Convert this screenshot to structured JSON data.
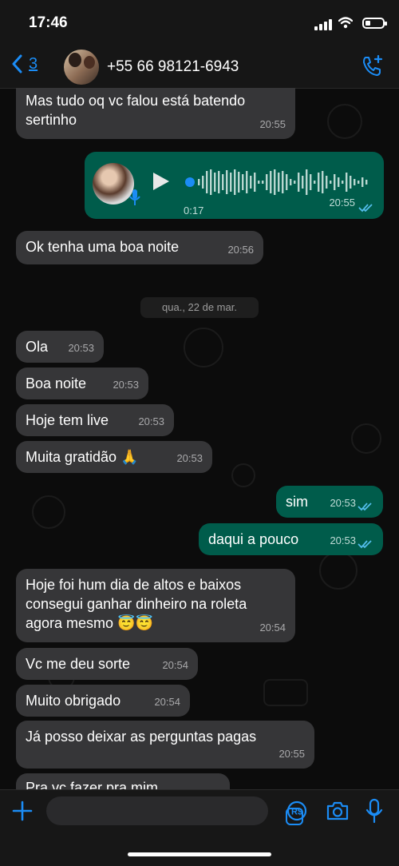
{
  "status": {
    "time": "17:46"
  },
  "header": {
    "back_count": "3",
    "contact": "+55 66 98121-6943"
  },
  "messages": [
    {
      "text": "Mas tudo oq vc falou está batendo sertinho",
      "time": "20:55"
    },
    {
      "time": "20:55"
    },
    {
      "text": "Ok tenha uma boa noite",
      "time": "20:56"
    },
    {
      "text": "Ola",
      "time": "20:53"
    },
    {
      "text": "Boa noite",
      "time": "20:53"
    },
    {
      "text": "Hoje tem live",
      "time": "20:53"
    },
    {
      "text": "Muita gratidão 🙏",
      "time": "20:53"
    },
    {
      "text": "sim",
      "time": "20:53"
    },
    {
      "text": "daqui a pouco",
      "time": "20:53"
    },
    {
      "text": "Hoje foi hum dia de altos e baixos consegui ganhar dinheiro na roleta agora mesmo 😇😇",
      "time": "20:54"
    },
    {
      "text": "Vc me deu sorte",
      "time": "20:54"
    },
    {
      "text": "Muito obrigado",
      "time": "20:54"
    },
    {
      "text": "Já posso deixar as perguntas pagas",
      "time": "20:55"
    },
    {
      "text": "Pra vc fazer pra mim"
    }
  ],
  "voice": {
    "duration": "0:17"
  },
  "date_chip": "qua., 22 de mar.",
  "icons": [
    "back-chevron-icon",
    "call-add-icon",
    "mic-icon",
    "play-icon",
    "plus-icon",
    "sticker-icon",
    "payment-icon",
    "camera-icon",
    "microphone-icon"
  ],
  "colors": {
    "accent": "#1b8cf5",
    "outgoing": "#005c4b",
    "incoming": "#363638",
    "read_ticks": "#53bdeb"
  }
}
